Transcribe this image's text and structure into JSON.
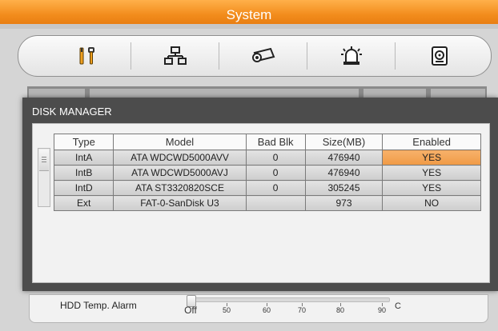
{
  "window": {
    "title": "System"
  },
  "toolbar": {
    "items": [
      {
        "icon": "tools-icon",
        "label": ""
      },
      {
        "icon": "network-icon",
        "label": ""
      },
      {
        "icon": "camera-icon",
        "label": ""
      },
      {
        "icon": "alarm-light-icon",
        "label": ""
      },
      {
        "icon": "hard-disk-icon",
        "label": ""
      }
    ]
  },
  "dialog": {
    "title": "DISK MANAGER",
    "columns": [
      "Type",
      "Model",
      "Bad Blk",
      "Size(MB)",
      "Enabled"
    ],
    "rows": [
      {
        "type": "IntA",
        "model": "ATA WDCWD5000AVV",
        "bad_blk": "0",
        "size": "476940",
        "enabled": "YES"
      },
      {
        "type": "IntB",
        "model": "ATA WDCWD5000AVJ",
        "bad_blk": "0",
        "size": "476940",
        "enabled": "YES"
      },
      {
        "type": "IntD",
        "model": "ATA ST3320820SCE",
        "bad_blk": "0",
        "size": "305245",
        "enabled": "YES"
      },
      {
        "type": "Ext",
        "model": "FAT-0-SanDisk U3",
        "bad_blk": "",
        "size": "973",
        "enabled": "NO"
      }
    ],
    "selected_cell": "YES",
    "accent_color": "#f09a45"
  },
  "hdd_temp_alarm": {
    "label": "HDD Temp. Alarm",
    "current_value": "Off",
    "scale": [
      "50",
      "60",
      "70",
      "80",
      "90"
    ],
    "unit": "C"
  }
}
